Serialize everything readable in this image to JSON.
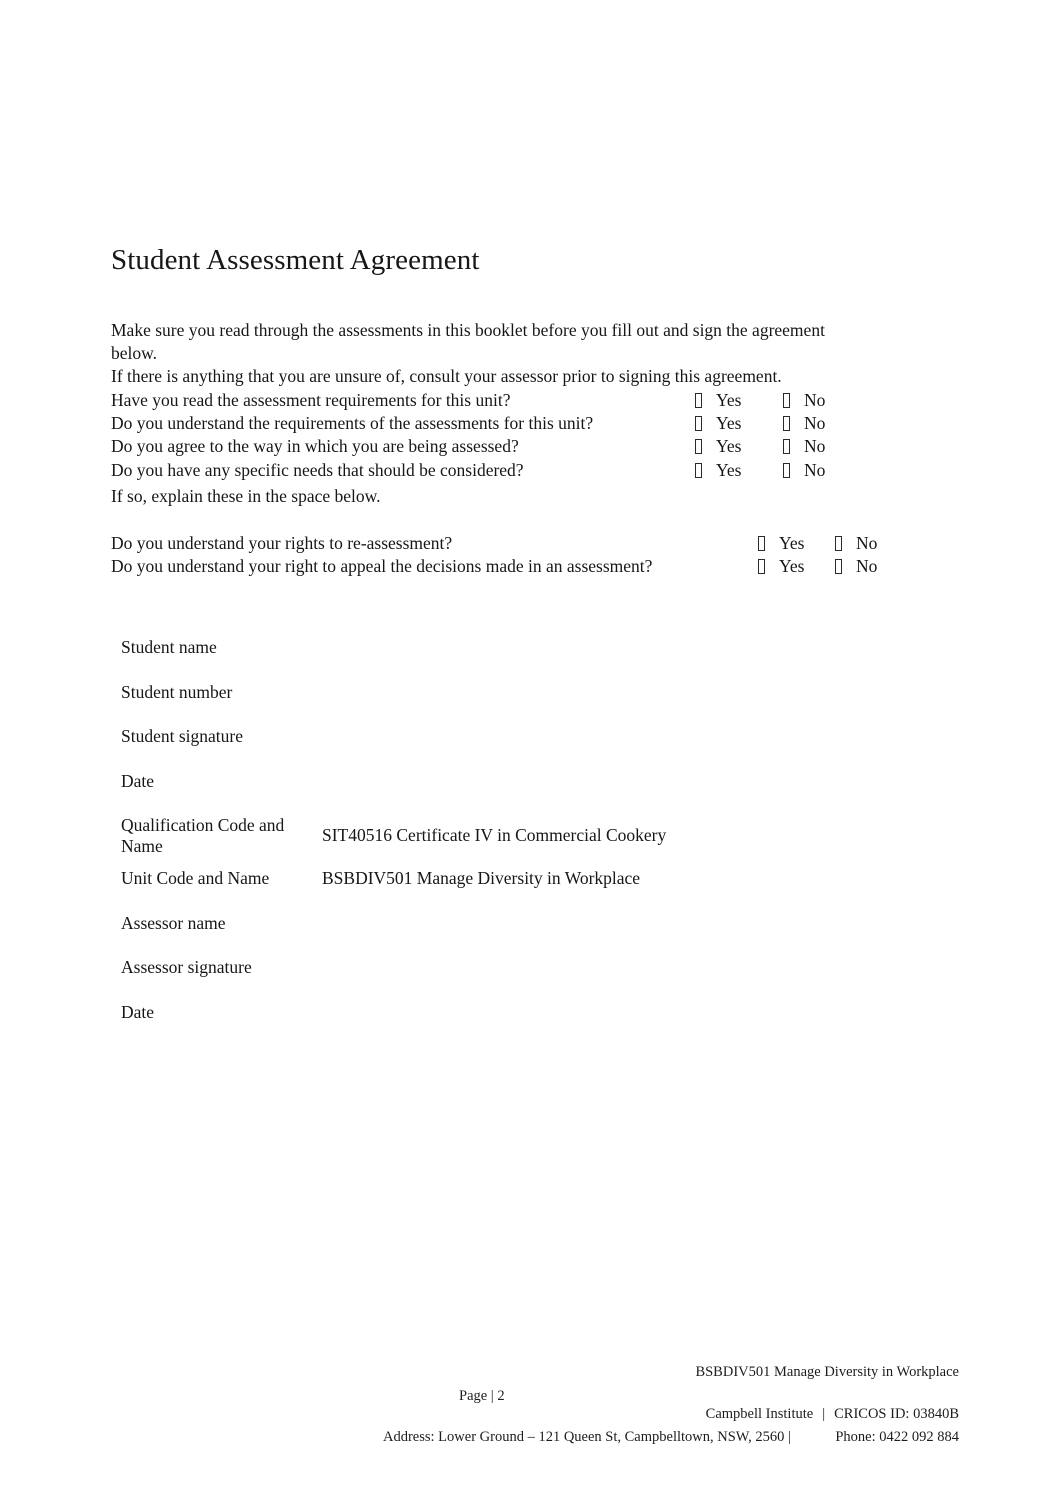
{
  "document": {
    "title": "Student Assessment Agreement"
  },
  "intro": {
    "line1": "Make sure you read through the assessments in this booklet before you fill out and sign the agreement below.",
    "line2": "If there is anything that you are unsure of, consult your assessor prior to signing this agreement."
  },
  "checkbox_glyph": "☐",
  "questions_primary": [
    {
      "text": "Have you read the assessment requirements for this unit?",
      "yes_label": "Yes",
      "no_label": "No"
    },
    {
      "text": "Do you understand the requirements of the assessments for this unit?",
      "yes_label": "Yes",
      "no_label": "No"
    },
    {
      "text": "Do you agree to the way in which you are being assessed?",
      "yes_label": "Yes",
      "no_label": "No"
    },
    {
      "text": "Do you have any specific needs that should be considered?",
      "yes_label": "Yes",
      "no_label": "No"
    }
  ],
  "note": "If so, explain these in the space below.",
  "questions_secondary": [
    {
      "text": "Do you understand your rights to re-assessment?",
      "yes_label": "Yes",
      "no_label": "No"
    },
    {
      "text": "Do you understand your right to appeal the decisions made in an assessment?",
      "yes_label": "Yes",
      "no_label": "No"
    }
  ],
  "details": [
    {
      "label": "Student name",
      "value": ""
    },
    {
      "label": "Student number",
      "value": ""
    },
    {
      "label": "Student signature",
      "value": ""
    },
    {
      "label": "Date",
      "value": ""
    },
    {
      "label": "Qualification Code and Name",
      "value": "SIT40516 Certificate IV in Commercial Cookery"
    },
    {
      "label": "Unit Code and Name",
      "value": "BSBDIV501 Manage Diversity in Workplace"
    },
    {
      "label": "Assessor name",
      "value": ""
    },
    {
      "label": "Assessor signature",
      "value": ""
    },
    {
      "label": "Date",
      "value": ""
    }
  ],
  "footer": {
    "unit": "BSBDIV501 Manage Diversity in Workplace",
    "page": "Page | 2",
    "organisation": "Campbell Institute",
    "separator": "|",
    "cricos": "CRICOS ID: 03840B",
    "address": "Address: Lower Ground – 121 Queen St, Campbelltown, NSW, 2560 |",
    "phone": "Phone: 0422 092 884"
  }
}
